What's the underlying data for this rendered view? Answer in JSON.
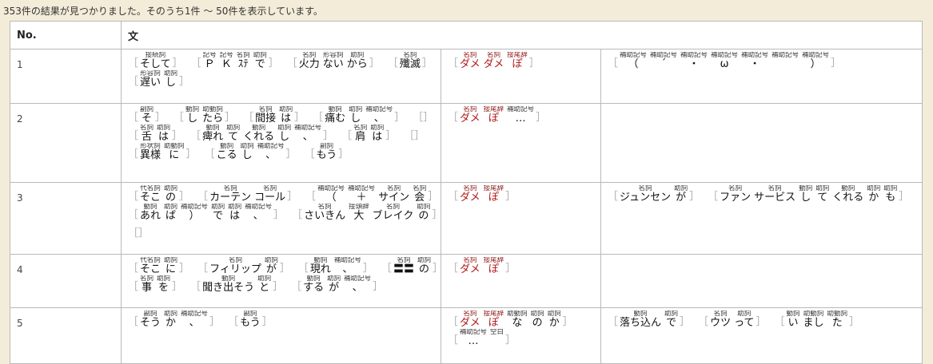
{
  "status": "353件の結果が見つかりました。そのうち1件 〜 50件を表示しています。",
  "headers": {
    "no": "No.",
    "sentence": "文"
  },
  "rows": [
    {
      "no": "1",
      "col1": [
        [
          [
            [
              "接続詞",
              "そして",
              false
            ]
          ],
          [
            [
              "記号",
              "Ｐ",
              false
            ],
            [
              "記号",
              "Ｋ",
              false
            ],
            [
              "名詞",
              "ｽﾃ",
              false
            ],
            [
              "助詞",
              "で",
              false
            ]
          ],
          [
            [
              "名詞",
              "火力",
              false
            ],
            [
              "形容詞",
              "ない",
              false
            ],
            [
              "助詞",
              "から",
              false
            ]
          ],
          [
            [
              "名詞",
              "殲滅",
              false
            ]
          ]
        ],
        [
          [
            [
              "形容詞",
              "遅い",
              false
            ],
            [
              "助詞",
              "し",
              false
            ]
          ]
        ]
      ],
      "col2": [
        [
          [
            [
              "名詞",
              "ダメ",
              true
            ],
            [
              "名詞",
              "ダメ",
              true
            ],
            [
              "接尾辞",
              "ぽ",
              true
            ]
          ]
        ]
      ],
      "col3": [
        [
          [
            [
              "補助記号",
              "（",
              false
            ],
            [
              "補助記号",
              "´",
              false
            ],
            [
              "補助記号",
              "・",
              false
            ],
            [
              "補助記号",
              "ω",
              false
            ],
            [
              "補助記号",
              "・",
              false
            ],
            [
              "補助記号",
              "",
              false
            ],
            [
              "補助記号",
              "）",
              false
            ]
          ]
        ]
      ]
    },
    {
      "no": "2",
      "col1": [
        [
          [
            [
              "副詞",
              "そ",
              false
            ]
          ],
          [
            [
              "動詞",
              "し",
              false
            ],
            [
              "助動詞",
              "たら",
              false
            ]
          ],
          [
            [
              "名詞",
              "間接",
              false
            ],
            [
              "助詞",
              "は",
              false
            ]
          ],
          [
            [
              "動詞",
              "痛む",
              false
            ],
            [
              "助詞",
              "し",
              false
            ],
            [
              "補助記号",
              "、",
              false
            ]
          ],
          []
        ],
        [
          [
            [
              "名詞",
              "舌",
              false
            ],
            [
              "助詞",
              "は",
              false
            ]
          ],
          [
            [
              "動詞",
              "痺れ",
              false
            ],
            [
              "助詞",
              "て",
              false
            ],
            [
              "動詞",
              "くれる",
              false
            ],
            [
              "助詞",
              "し",
              false
            ],
            [
              "補助記号",
              "、",
              false
            ]
          ],
          [
            [
              "名詞",
              "肩",
              false
            ],
            [
              "助詞",
              "は",
              false
            ]
          ],
          []
        ],
        [
          [
            [
              "形状詞",
              "異様",
              false
            ],
            [
              "助動詞",
              "に",
              false
            ]
          ],
          [
            [
              "動詞",
              "こる",
              false
            ],
            [
              "助詞",
              "し",
              false
            ],
            [
              "補助記号",
              "、",
              false
            ]
          ],
          [
            [
              "副詞",
              "もう",
              false
            ]
          ]
        ]
      ],
      "col2": [
        [
          [
            [
              "名詞",
              "ダメ",
              true
            ],
            [
              "接尾辞",
              "ぽ",
              true
            ],
            [
              "補助記号",
              "…",
              false
            ]
          ]
        ]
      ],
      "col3": []
    },
    {
      "no": "3",
      "col1": [
        [
          [
            [
              "代名詞",
              "そこ",
              false
            ],
            [
              "助詞",
              "の",
              false
            ]
          ],
          [
            [
              "名詞",
              "カーテン",
              false
            ],
            [
              "名詞",
              "コール",
              false
            ]
          ],
          [
            [
              "補助記号",
              "（",
              false
            ],
            [
              "補助記号",
              "＋",
              false
            ],
            [
              "名詞",
              "サイン",
              false
            ],
            [
              "名詞",
              "会",
              false
            ]
          ]
        ],
        [
          [
            [
              "動詞",
              "あれ",
              false
            ],
            [
              "助詞",
              "ば",
              false
            ],
            [
              "補助記号",
              "）",
              false
            ],
            [
              "助詞",
              "で",
              false
            ],
            [
              "助詞",
              "は",
              false
            ],
            [
              "補助記号",
              "、",
              false
            ]
          ],
          [
            [
              "名詞",
              "さいきん",
              false
            ],
            [
              "接頭辞",
              "大",
              false
            ],
            [
              "名詞",
              "ブレイク",
              false
            ],
            [
              "助詞",
              "の",
              false
            ]
          ]
        ],
        [
          []
        ]
      ],
      "col2": [
        [
          [
            [
              "名詞",
              "ダメ",
              true
            ],
            [
              "接尾辞",
              "ぽ",
              true
            ]
          ]
        ]
      ],
      "col3": [
        [
          [
            [
              "名詞",
              "ジュンセン",
              false
            ],
            [
              "助詞",
              "が",
              false
            ]
          ],
          [
            [
              "名詞",
              "ファン",
              false
            ],
            [
              "名詞",
              "サービス",
              false
            ],
            [
              "動詞",
              "し",
              false
            ],
            [
              "助詞",
              "て",
              false
            ],
            [
              "動詞",
              "くれる",
              false
            ],
            [
              "助詞",
              "か",
              false
            ],
            [
              "助詞",
              "も",
              false
            ]
          ]
        ]
      ]
    },
    {
      "no": "4",
      "col1": [
        [
          [
            [
              "代名詞",
              "そこ",
              false
            ],
            [
              "助詞",
              "に",
              false
            ]
          ],
          [
            [
              "名詞",
              "フィリップ",
              false
            ],
            [
              "助詞",
              "が",
              false
            ]
          ],
          [
            [
              "動詞",
              "現れ",
              false
            ],
            [
              "補助記号",
              "、",
              false
            ]
          ],
          [
            [
              "名詞",
              "〓〓",
              false
            ],
            [
              "助詞",
              "の",
              false
            ]
          ]
        ],
        [
          [
            [
              "名詞",
              "事",
              false
            ],
            [
              "助詞",
              "を",
              false
            ]
          ],
          [
            [
              "動詞",
              "聞き出そう",
              false
            ],
            [
              "助詞",
              "と",
              false
            ]
          ],
          [
            [
              "動詞",
              "する",
              false
            ],
            [
              "助詞",
              "が",
              false
            ],
            [
              "補助記号",
              "、",
              false
            ]
          ]
        ]
      ],
      "col2": [
        [
          [
            [
              "名詞",
              "ダメ",
              true
            ],
            [
              "接尾辞",
              "ぽ",
              true
            ]
          ]
        ]
      ],
      "col3": []
    },
    {
      "no": "5",
      "col1": [
        [
          [
            [
              "副詞",
              "そう",
              false
            ],
            [
              "助詞",
              "か",
              false
            ],
            [
              "補助記号",
              "、",
              false
            ]
          ],
          [
            [
              "副詞",
              "もう",
              false
            ]
          ]
        ]
      ],
      "col2": [
        [
          [
            [
              "名詞",
              "ダメ",
              true
            ],
            [
              "接尾辞",
              "ぽ",
              true
            ],
            [
              "助動詞",
              "な",
              false
            ],
            [
              "助詞",
              "の",
              false
            ],
            [
              "助詞",
              "か",
              false
            ]
          ]
        ],
        [
          [
            [
              "補助記号",
              "…",
              false
            ],
            [
              "空白",
              "",
              false
            ]
          ]
        ]
      ],
      "col3": [
        [
          [
            [
              "動詞",
              "落ち込ん",
              false
            ],
            [
              "助詞",
              "で",
              false
            ]
          ],
          [
            [
              "名詞",
              "ウツ",
              false
            ],
            [
              "助詞",
              "って",
              false
            ]
          ],
          [
            [
              "動詞",
              "い",
              false
            ],
            [
              "助動詞",
              "まし",
              false
            ],
            [
              "助動詞",
              "た",
              false
            ]
          ]
        ]
      ]
    }
  ]
}
